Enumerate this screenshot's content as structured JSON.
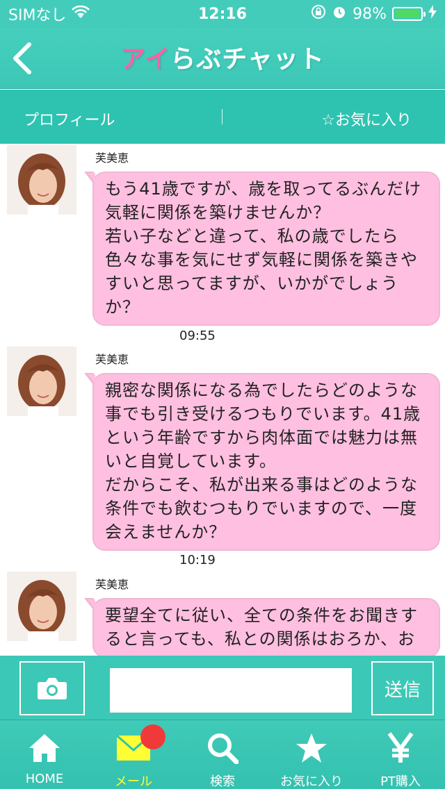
{
  "status_bar": {
    "carrier": "SIMなし",
    "time": "12:16",
    "battery_percent": "98%",
    "battery_level": 0.98,
    "icons": [
      "wifi-icon",
      "orientation-lock-icon",
      "alarm-icon",
      "battery-icon",
      "charging-icon"
    ]
  },
  "header": {
    "back_icon": "chevron-left-icon",
    "logo_part1": "アイ",
    "logo_part2": "らぶチャット"
  },
  "tabs": {
    "profile": "プロフィール",
    "favorite": "☆お気に入り"
  },
  "messages": [
    {
      "sender": "芙美恵",
      "text": "もう41歳ですが、歳を取ってるぶんだけ気軽に関係を築けませんか？\n若い子などと違って、私の歳でしたら色々な事を気にせず気軽に関係を築きやすいと思ってますが、いかがでしょうか？",
      "time": "09:55"
    },
    {
      "sender": "芙美恵",
      "text": "親密な関係になる為でしたらどのような事でも引き受けるつもりでいます。41歳という年齢ですから肉体面では魅力は無いと自覚しています。\nだからこそ、私が出来る事はどのような条件でも飲むつもりでいますので、一度会えませんか？",
      "time": "10:19"
    },
    {
      "sender": "芙美恵",
      "text": "要望全てに従い、全ての条件をお聞きすると言っても、私との関係はおろか、お",
      "time": ""
    }
  ],
  "input_bar": {
    "camera_icon": "camera-icon",
    "input_value": "",
    "input_placeholder": "",
    "send_label": "送信"
  },
  "bottom_nav": [
    {
      "label": "HOME",
      "icon": "home-icon",
      "active": false
    },
    {
      "label": "メール",
      "icon": "mail-icon",
      "active": true,
      "badge": true
    },
    {
      "label": "検索",
      "icon": "search-icon",
      "active": false
    },
    {
      "label": "お気に入り",
      "icon": "star-icon",
      "active": false
    },
    {
      "label": "PT購入",
      "icon": "yen-icon",
      "active": false
    }
  ],
  "colors": {
    "teal": "#3cc8b6",
    "bubble_pink": "#ffbfe0",
    "active_yellow": "#ffff33",
    "badge_red": "#f03a3a"
  }
}
